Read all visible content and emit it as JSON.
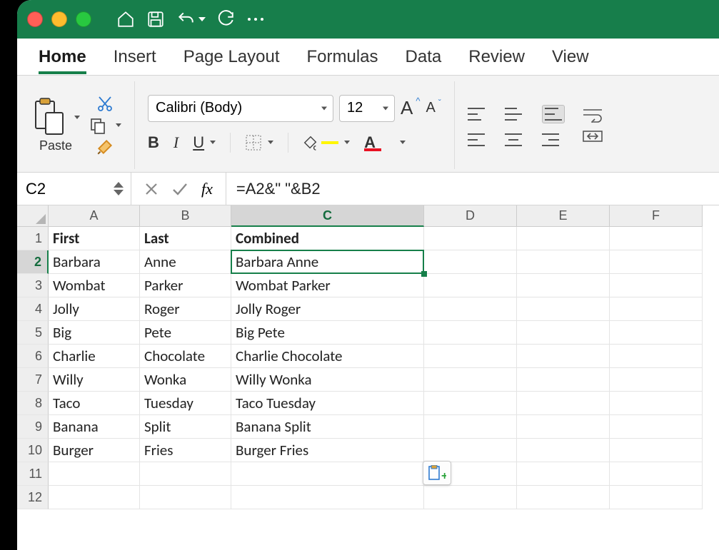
{
  "tabs": {
    "home": "Home",
    "insert": "Insert",
    "page_layout": "Page Layout",
    "formulas": "Formulas",
    "data": "Data",
    "review": "Review",
    "view": "View"
  },
  "ribbon": {
    "paste_label": "Paste",
    "font_name": "Calibri (Body)",
    "font_size": "12",
    "btn_B": "B",
    "btn_I": "I",
    "btn_U": "U",
    "btn_A": "A",
    "font_larger": "A",
    "font_smaller": "A"
  },
  "formula": {
    "cell_ref": "C2",
    "fx_label": "fx",
    "content": "=A2&\" \"&B2"
  },
  "columns": [
    "A",
    "B",
    "C",
    "D",
    "E",
    "F"
  ],
  "col_widths": [
    "colA",
    "colB",
    "colC",
    "colDEF",
    "colDEF",
    "colDEF"
  ],
  "selected_col_index": 2,
  "selected_row_index": 1,
  "row_numbers": [
    1,
    2,
    3,
    4,
    5,
    6,
    7,
    8,
    9,
    10,
    11,
    12
  ],
  "rows": [
    {
      "a": "First",
      "b": "Last",
      "c": "Combined",
      "header": true
    },
    {
      "a": "Barbara",
      "b": "Anne",
      "c": "Barbara Anne"
    },
    {
      "a": "Wombat",
      "b": "Parker",
      "c": "Wombat Parker"
    },
    {
      "a": "Jolly",
      "b": "Roger",
      "c": "Jolly Roger"
    },
    {
      "a": "Big",
      "b": "Pete",
      "c": "Big Pete"
    },
    {
      "a": "Charlie",
      "b": "Chocolate",
      "c": "Charlie Chocolate"
    },
    {
      "a": "Willy",
      "b": "Wonka",
      "c": "Willy Wonka"
    },
    {
      "a": "Taco",
      "b": "Tuesday",
      "c": "Taco Tuesday"
    },
    {
      "a": "Banana",
      "b": "Split",
      "c": "Banana Split"
    },
    {
      "a": "Burger",
      "b": "Fries",
      "c": "Burger Fries"
    },
    {
      "a": "",
      "b": "",
      "c": ""
    },
    {
      "a": "",
      "b": "",
      "c": ""
    }
  ]
}
